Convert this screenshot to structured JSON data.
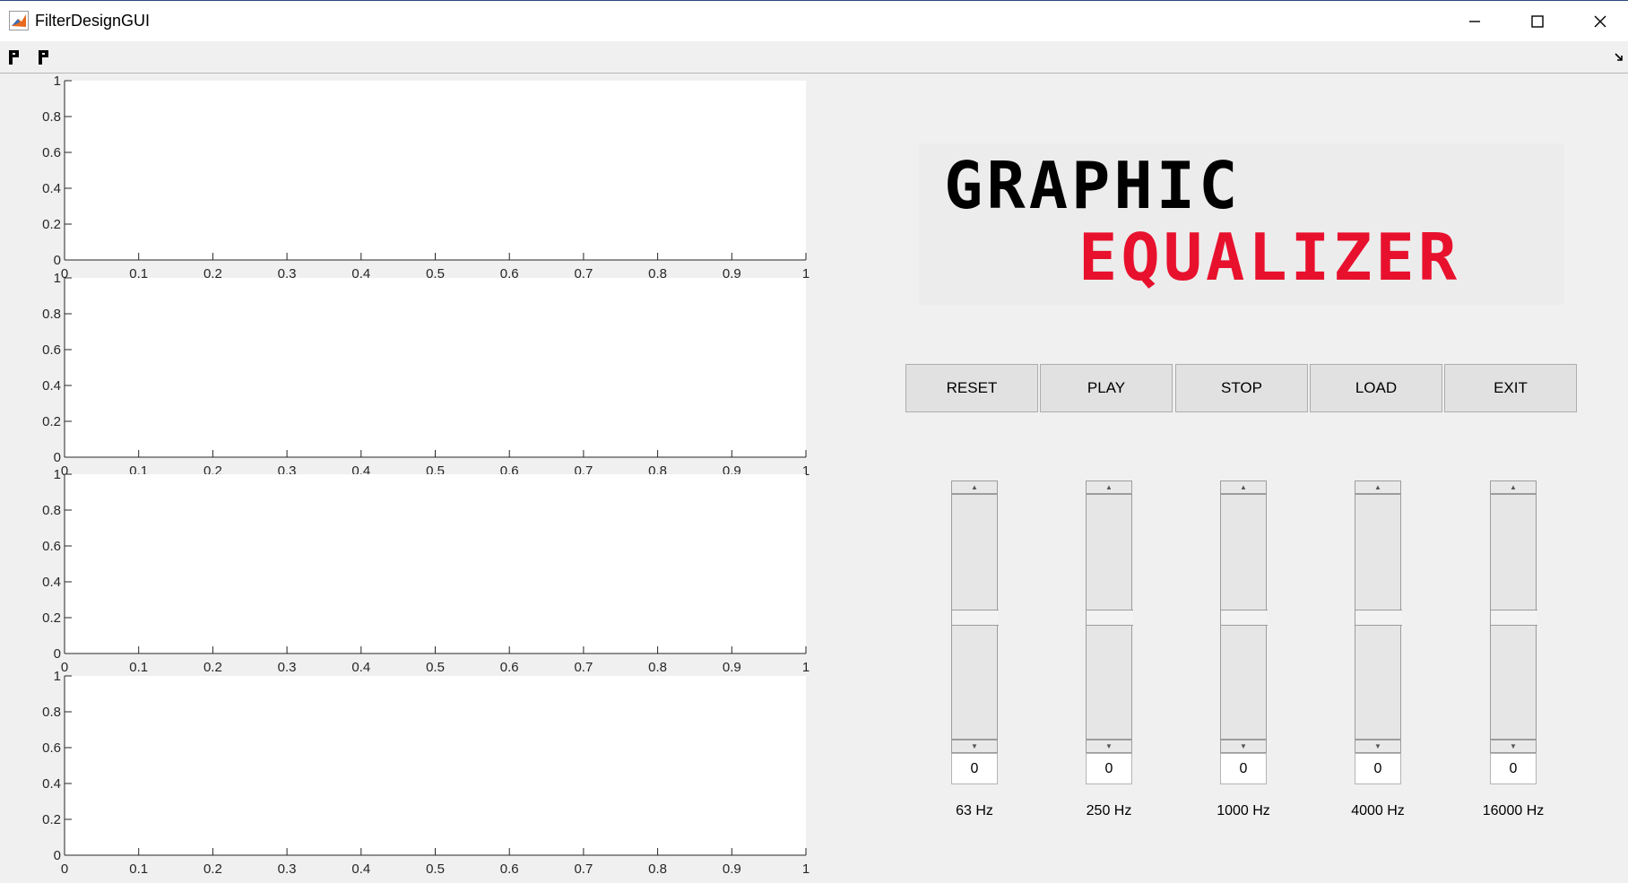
{
  "window": {
    "title": "FilterDesignGUI"
  },
  "axes": {
    "ticks": [
      "0",
      "0.1",
      "0.2",
      "0.3",
      "0.4",
      "0.5",
      "0.6",
      "0.7",
      "0.8",
      "0.9",
      "1"
    ],
    "ytick_labels": [
      "0",
      "0.2",
      "0.4",
      "0.6",
      "0.8",
      "1"
    ],
    "xtick_labels": [
      "0",
      "0.1",
      "0.2",
      "0.3",
      "0.4",
      "0.5",
      "0.6",
      "0.7",
      "0.8",
      "0.9",
      "1"
    ],
    "count": 4
  },
  "logo": {
    "line1": "GRAPHIC",
    "line2": "EQUALIZER",
    "color1": "#000000",
    "color2": "#e8112d"
  },
  "buttons": {
    "reset": "RESET",
    "play": "PLAY",
    "stop": "STOP",
    "load": "LOAD",
    "exit": "EXIT"
  },
  "bands": [
    {
      "label": "63 Hz",
      "value": "0"
    },
    {
      "label": "250 Hz",
      "value": "0"
    },
    {
      "label": "1000 Hz",
      "value": "0"
    },
    {
      "label": "4000 Hz",
      "value": "0"
    },
    {
      "label": "16000 Hz",
      "value": "0"
    }
  ]
}
